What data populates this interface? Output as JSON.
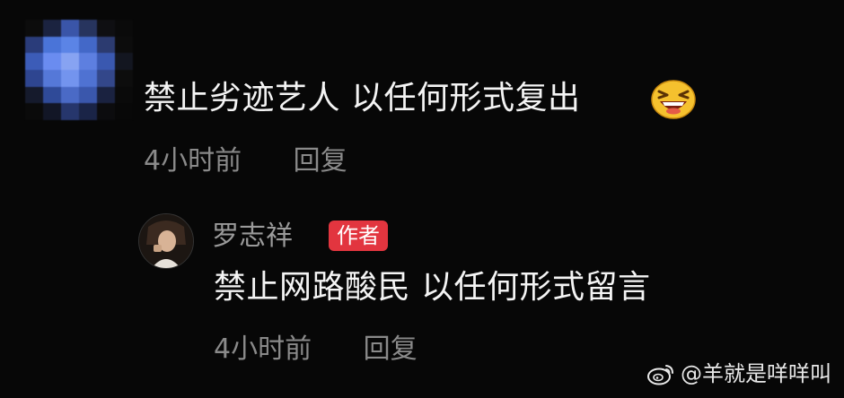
{
  "top_comment": {
    "avatar": "pixelated-avatar",
    "text": "禁止劣迹艺人 以任何形式复出",
    "emoji": "laughing-emoji-icon",
    "time": "4小时前",
    "reply_label": "回复"
  },
  "reply_comment": {
    "avatar": "author-avatar",
    "author": "罗志祥",
    "badge": "作者",
    "text": "禁止网路酸民 以任何形式留言",
    "time": "4小时前",
    "reply_label": "回复"
  },
  "watermark": {
    "icon": "weibo-icon",
    "text": "@羊就是咩咩叫"
  },
  "colors": {
    "background": "#070707",
    "text_primary": "#f4f4f4",
    "text_secondary": "#8a8a8a",
    "badge": "#e2353f",
    "avatar_blue": "#3f6cd6"
  }
}
